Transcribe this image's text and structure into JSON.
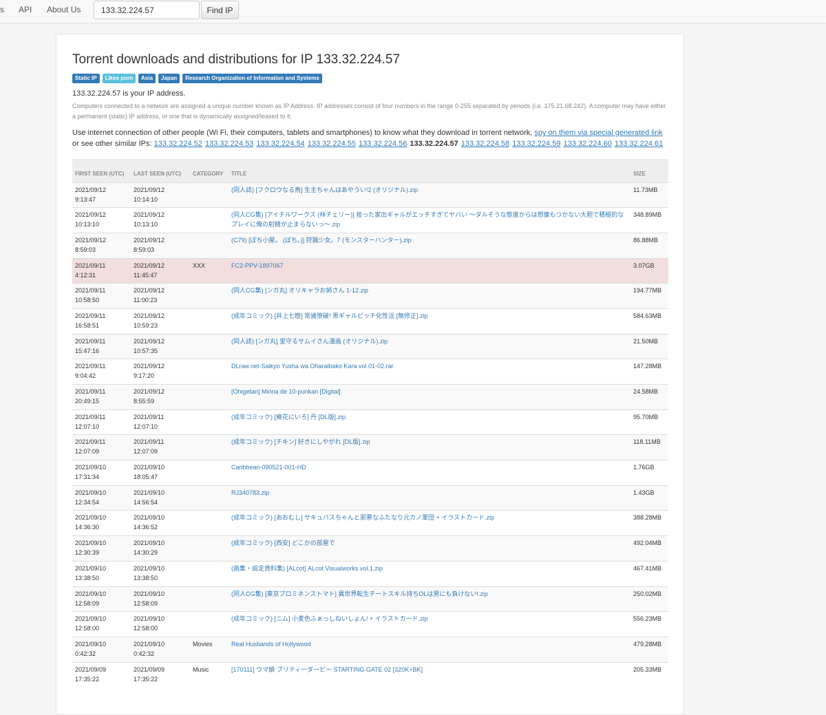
{
  "nav": {
    "cut_item": "s",
    "api": "API",
    "about": "About Us",
    "search_value": "133.32.224.57",
    "find_button": "Find IP"
  },
  "page": {
    "title": "Torrent downloads and distributions for IP 133.32.224.57",
    "badges": [
      {
        "label": "Static IP",
        "color": "#337ab7"
      },
      {
        "label": "Likes porn",
        "color": "#5bc0de"
      },
      {
        "label": "Asia",
        "color": "#337ab7"
      },
      {
        "label": "Japan",
        "color": "#337ab7"
      },
      {
        "label": "Research Organization of Information and Systems",
        "color": "#337ab7"
      }
    ],
    "your_ip": "133.32.224.57 is your IP address.",
    "explanation": "Computers connected to a network are assigned a unique number known as IP Address. IP addresses consist of four numbers in the range 0-255 separated by periods (i.e. 175.21.68.242). A computer may have either a permanent (static) IP address, or one that is dynamically assigned/leased to it.",
    "spy_prefix": "Use internet connection of other people (Wi Fi, their computers, tablets and smartphones) to know what they download in torrent network,",
    "spy_link": "spy on them via special generated link",
    "similar_prefix": "or see other similar IPs:",
    "similar_ips": [
      "133.32.224.52",
      "133.32.224.53",
      "133.32.224.54",
      "133.32.224.55",
      "133.32.224.56",
      "133.32.224.57",
      "133.32.224.58",
      "133.32.224.59",
      "133.32.224.60",
      "133.32.224.61"
    ],
    "current_ip": "133.32.224.57"
  },
  "table": {
    "headers": {
      "first_seen": "FIRST SEEN (UTC)",
      "last_seen": "LAST SEEN (UTC)",
      "category": "CATEGORY",
      "title": "TITLE",
      "size": "SIZE"
    },
    "rows": [
      {
        "first_date": "2021/09/12",
        "first_time": "9:13:47",
        "last_date": "2021/09/12",
        "last_time": "10:14:10",
        "category": "",
        "title": "(同人誌) [フクロウなる鳥] 生主ちゃんはあやうい!2 (オリジナル).zip",
        "size": "11.73MB"
      },
      {
        "first_date": "2021/09/12",
        "first_time": "10:13:10",
        "last_date": "2021/09/12",
        "last_time": "10:13:10",
        "category": "",
        "title": "(同人CG集) [アイチルワークス (林チェリー)] 拾った家出ギャルがエッチすぎてヤバい 〜ダルそうな態度からは想像もつかない大胆で積極的なプレイに俺の射精が止まらないっ〜.zip",
        "size": "348.89MB"
      },
      {
        "first_date": "2021/09/12",
        "first_time": "8:59:03",
        "last_date": "2021/09/12",
        "last_time": "8:59:03",
        "category": "",
        "title": "(C79) [ぽち小屋。 (ぽち。)] 狩猟少女。7 (モンスターハンター).zip",
        "size": "86.88MB"
      },
      {
        "first_date": "2021/09/11",
        "first_time": "4:12:31",
        "last_date": "2021/09/12",
        "last_time": "11:45:47",
        "category": "XXX",
        "title": "FC2-PPV-1897067",
        "size": "3.07GB",
        "highlight": true
      },
      {
        "first_date": "2021/09/11",
        "first_time": "10:58:50",
        "last_date": "2021/09/12",
        "last_time": "11:00:23",
        "category": "",
        "title": "(同人CG集) [ンガ丸] オリキャラお姉さん 1-12.zip",
        "size": "194.77MB"
      },
      {
        "first_date": "2021/09/11",
        "first_time": "16:58:51",
        "last_date": "2021/09/12",
        "last_time": "10:59:23",
        "category": "",
        "title": "(成年コミック) [井上七樹] 常識堕破! 黒ギャルビッチ化性活 [無修正].zip",
        "size": "584.63MB"
      },
      {
        "first_date": "2021/09/11",
        "first_time": "15:47:16",
        "last_date": "2021/09/12",
        "last_time": "10:57:35",
        "category": "",
        "title": "(同人誌) [ンガ丸] 里守るサムイさん漫画 (オリジナル).zip",
        "size": "21.50MB"
      },
      {
        "first_date": "2021/09/11",
        "first_time": "9:04:42",
        "last_date": "2021/09/12",
        "last_time": "9:17:20",
        "category": "",
        "title": "DLraw.net-Saikyo Yusha wa Oharaibako Kara vol 01-02.rar",
        "size": "147.28MB"
      },
      {
        "first_date": "2021/09/11",
        "first_time": "20:49:15",
        "last_date": "2021/09/12",
        "last_time": "8:55:59",
        "category": "",
        "title": "[Ohigetan] Minna de 10-punkan [Digital]",
        "size": "24.58MB"
      },
      {
        "first_date": "2021/09/11",
        "first_time": "12:07:10",
        "last_date": "2021/09/11",
        "last_time": "12:07:10",
        "category": "",
        "title": "(成年コミック) [幾花にいろ] 丹 [DL版].zip",
        "size": "95.70MB"
      },
      {
        "first_date": "2021/09/11",
        "first_time": "12:07:09",
        "last_date": "2021/09/11",
        "last_time": "12:07:09",
        "category": "",
        "title": "(成年コミック) [チキン] 好きにしやがれ [DL版].zip",
        "size": "118.11MB"
      },
      {
        "first_date": "2021/09/10",
        "first_time": "17:31:34",
        "last_date": "2021/09/10",
        "last_time": "18:05:47",
        "category": "",
        "title": "Caribbean-090521-001-HD",
        "size": "1.76GB"
      },
      {
        "first_date": "2021/09/10",
        "first_time": "12:34:54",
        "last_date": "2021/09/10",
        "last_time": "14:56:54",
        "category": "",
        "title": "RJ340783.zip",
        "size": "1.43GB"
      },
      {
        "first_date": "2021/09/10",
        "first_time": "14:36:30",
        "last_date": "2021/09/10",
        "last_time": "14:36:52",
        "category": "",
        "title": "(成年コミック) [あおむし] サキュバスちゃんと邪悪なふたなり元カノ軍団 + イラストカード.zip",
        "size": "388.28MB"
      },
      {
        "first_date": "2021/09/10",
        "first_time": "12:30:39",
        "last_date": "2021/09/10",
        "last_time": "14:30:29",
        "category": "",
        "title": "(成年コミック) [西安] どこかの部屋で",
        "size": "492.04MB"
      },
      {
        "first_date": "2021/09/10",
        "first_time": "13:38:50",
        "last_date": "2021/09/10",
        "last_time": "13:38:50",
        "category": "",
        "title": "(画集・設定資料集) [ALcot] ALcot Visualworks vol.1.zip",
        "size": "467.41MB"
      },
      {
        "first_date": "2021/09/10",
        "first_time": "12:58:09",
        "last_date": "2021/09/10",
        "last_time": "12:58:09",
        "category": "",
        "title": "(同人CG集) [東京プロミネンストマト] 異世界転生チートスキル持ちOLは男にも負けない!.zip",
        "size": "250.02MB"
      },
      {
        "first_date": "2021/09/10",
        "first_time": "12:58:00",
        "last_date": "2021/09/10",
        "last_time": "12:58:00",
        "category": "",
        "title": "(成年コミック) [ニム] 小麦色ふぁっしねいしょん! + イラストカード.zip",
        "size": "556.23MB"
      },
      {
        "first_date": "2021/09/10",
        "first_time": "0:42:32",
        "last_date": "2021/09/10",
        "last_time": "0:42:32",
        "category": "Movies",
        "title": "Real Husbands of Hollywood",
        "size": "479.28MB"
      },
      {
        "first_date": "2021/09/09",
        "first_time": "17:35:22",
        "last_date": "2021/09/09",
        "last_time": "17:35:22",
        "category": "Music",
        "title": "[170111] ウマ娘 プリティーダービー STARTING GATE 02 [320K+BK]",
        "size": "205.33MB"
      }
    ]
  }
}
